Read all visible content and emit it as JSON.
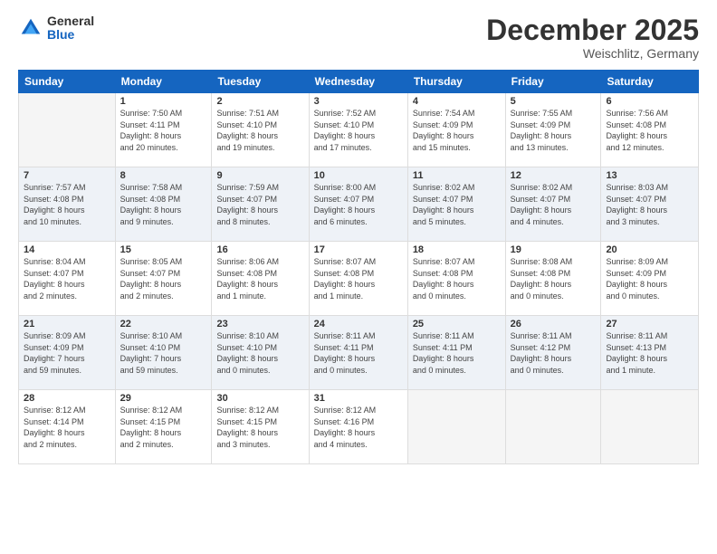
{
  "logo": {
    "general": "General",
    "blue": "Blue"
  },
  "title": "December 2025",
  "location": "Weischlitz, Germany",
  "weekdays": [
    "Sunday",
    "Monday",
    "Tuesday",
    "Wednesday",
    "Thursday",
    "Friday",
    "Saturday"
  ],
  "weeks": [
    [
      {
        "day": "",
        "info": ""
      },
      {
        "day": "1",
        "info": "Sunrise: 7:50 AM\nSunset: 4:11 PM\nDaylight: 8 hours\nand 20 minutes."
      },
      {
        "day": "2",
        "info": "Sunrise: 7:51 AM\nSunset: 4:10 PM\nDaylight: 8 hours\nand 19 minutes."
      },
      {
        "day": "3",
        "info": "Sunrise: 7:52 AM\nSunset: 4:10 PM\nDaylight: 8 hours\nand 17 minutes."
      },
      {
        "day": "4",
        "info": "Sunrise: 7:54 AM\nSunset: 4:09 PM\nDaylight: 8 hours\nand 15 minutes."
      },
      {
        "day": "5",
        "info": "Sunrise: 7:55 AM\nSunset: 4:09 PM\nDaylight: 8 hours\nand 13 minutes."
      },
      {
        "day": "6",
        "info": "Sunrise: 7:56 AM\nSunset: 4:08 PM\nDaylight: 8 hours\nand 12 minutes."
      }
    ],
    [
      {
        "day": "7",
        "info": "Sunrise: 7:57 AM\nSunset: 4:08 PM\nDaylight: 8 hours\nand 10 minutes."
      },
      {
        "day": "8",
        "info": "Sunrise: 7:58 AM\nSunset: 4:08 PM\nDaylight: 8 hours\nand 9 minutes."
      },
      {
        "day": "9",
        "info": "Sunrise: 7:59 AM\nSunset: 4:07 PM\nDaylight: 8 hours\nand 8 minutes."
      },
      {
        "day": "10",
        "info": "Sunrise: 8:00 AM\nSunset: 4:07 PM\nDaylight: 8 hours\nand 6 minutes."
      },
      {
        "day": "11",
        "info": "Sunrise: 8:02 AM\nSunset: 4:07 PM\nDaylight: 8 hours\nand 5 minutes."
      },
      {
        "day": "12",
        "info": "Sunrise: 8:02 AM\nSunset: 4:07 PM\nDaylight: 8 hours\nand 4 minutes."
      },
      {
        "day": "13",
        "info": "Sunrise: 8:03 AM\nSunset: 4:07 PM\nDaylight: 8 hours\nand 3 minutes."
      }
    ],
    [
      {
        "day": "14",
        "info": "Sunrise: 8:04 AM\nSunset: 4:07 PM\nDaylight: 8 hours\nand 2 minutes."
      },
      {
        "day": "15",
        "info": "Sunrise: 8:05 AM\nSunset: 4:07 PM\nDaylight: 8 hours\nand 2 minutes."
      },
      {
        "day": "16",
        "info": "Sunrise: 8:06 AM\nSunset: 4:08 PM\nDaylight: 8 hours\nand 1 minute."
      },
      {
        "day": "17",
        "info": "Sunrise: 8:07 AM\nSunset: 4:08 PM\nDaylight: 8 hours\nand 1 minute."
      },
      {
        "day": "18",
        "info": "Sunrise: 8:07 AM\nSunset: 4:08 PM\nDaylight: 8 hours\nand 0 minutes."
      },
      {
        "day": "19",
        "info": "Sunrise: 8:08 AM\nSunset: 4:08 PM\nDaylight: 8 hours\nand 0 minutes."
      },
      {
        "day": "20",
        "info": "Sunrise: 8:09 AM\nSunset: 4:09 PM\nDaylight: 8 hours\nand 0 minutes."
      }
    ],
    [
      {
        "day": "21",
        "info": "Sunrise: 8:09 AM\nSunset: 4:09 PM\nDaylight: 7 hours\nand 59 minutes."
      },
      {
        "day": "22",
        "info": "Sunrise: 8:10 AM\nSunset: 4:10 PM\nDaylight: 7 hours\nand 59 minutes."
      },
      {
        "day": "23",
        "info": "Sunrise: 8:10 AM\nSunset: 4:10 PM\nDaylight: 8 hours\nand 0 minutes."
      },
      {
        "day": "24",
        "info": "Sunrise: 8:11 AM\nSunset: 4:11 PM\nDaylight: 8 hours\nand 0 minutes."
      },
      {
        "day": "25",
        "info": "Sunrise: 8:11 AM\nSunset: 4:11 PM\nDaylight: 8 hours\nand 0 minutes."
      },
      {
        "day": "26",
        "info": "Sunrise: 8:11 AM\nSunset: 4:12 PM\nDaylight: 8 hours\nand 0 minutes."
      },
      {
        "day": "27",
        "info": "Sunrise: 8:11 AM\nSunset: 4:13 PM\nDaylight: 8 hours\nand 1 minute."
      }
    ],
    [
      {
        "day": "28",
        "info": "Sunrise: 8:12 AM\nSunset: 4:14 PM\nDaylight: 8 hours\nand 2 minutes."
      },
      {
        "day": "29",
        "info": "Sunrise: 8:12 AM\nSunset: 4:15 PM\nDaylight: 8 hours\nand 2 minutes."
      },
      {
        "day": "30",
        "info": "Sunrise: 8:12 AM\nSunset: 4:15 PM\nDaylight: 8 hours\nand 3 minutes."
      },
      {
        "day": "31",
        "info": "Sunrise: 8:12 AM\nSunset: 4:16 PM\nDaylight: 8 hours\nand 4 minutes."
      },
      {
        "day": "",
        "info": ""
      },
      {
        "day": "",
        "info": ""
      },
      {
        "day": "",
        "info": ""
      }
    ]
  ]
}
